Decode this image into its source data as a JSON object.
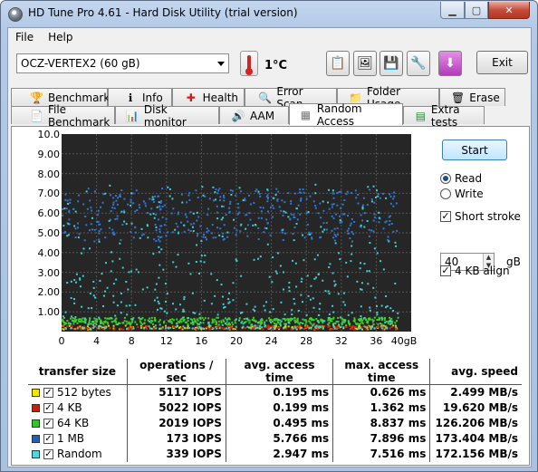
{
  "window": {
    "title": "HD Tune Pro 4.61 - Hard Disk Utility (trial version)"
  },
  "menu": [
    "File",
    "Help"
  ],
  "toolbar": {
    "drive": "OCZ-VERTEX2 (60 gB)",
    "temperature": "1°C",
    "exit_label": "Exit"
  },
  "tabs_row1": [
    {
      "label": "Benchmark",
      "icon": "benchmark-icon",
      "glyph": "🏆"
    },
    {
      "label": "Info",
      "icon": "info-icon",
      "glyph": "ℹ"
    },
    {
      "label": "Health",
      "icon": "health-icon",
      "glyph": "✚"
    },
    {
      "label": "Error Scan",
      "icon": "error-scan-icon",
      "glyph": "🔍"
    },
    {
      "label": "Folder Usage",
      "icon": "folder-icon",
      "glyph": "📁"
    },
    {
      "label": "Erase",
      "icon": "erase-icon",
      "glyph": "🗑"
    }
  ],
  "tabs_row2": [
    {
      "label": "File Benchmark",
      "icon": "file-benchmark-icon",
      "glyph": "📄"
    },
    {
      "label": "Disk monitor",
      "icon": "disk-monitor-icon",
      "glyph": "📊"
    },
    {
      "label": "AAM",
      "icon": "speaker-icon",
      "glyph": "🔊"
    },
    {
      "label": "Random Access",
      "icon": "random-access-icon",
      "glyph": "▦"
    },
    {
      "label": "Extra tests",
      "icon": "extra-tests-icon",
      "glyph": "▤"
    }
  ],
  "controls": {
    "start_label": "Start",
    "read_label": "Read",
    "write_label": "Write",
    "mode": "read",
    "short_stroke_label": "Short stroke",
    "short_stroke_checked": true,
    "short_stroke_value": "40",
    "short_stroke_unit": "gB",
    "align_label": "4 KB align",
    "align_checked": true
  },
  "chart_data": {
    "type": "scatter",
    "ylabel": "ms",
    "ylim": [
      0,
      10
    ],
    "xlim": [
      0,
      40
    ],
    "yticks": [
      "10.0",
      "9.00",
      "8.00",
      "7.00",
      "6.00",
      "5.00",
      "4.00",
      "3.00",
      "2.00",
      "1.00"
    ],
    "xticks": [
      "0",
      "4",
      "8",
      "12",
      "16",
      "20",
      "24",
      "28",
      "32",
      "36",
      "40gB"
    ],
    "series": [
      {
        "name": "512 bytes",
        "color": "#e8d400",
        "y_range": [
          0.15,
          0.35
        ]
      },
      {
        "name": "4 KB",
        "color": "#d42a10",
        "y_range": [
          0.15,
          0.35
        ]
      },
      {
        "name": "64 KB",
        "color": "#3fcf2a",
        "y_range": [
          0.4,
          0.75
        ]
      },
      {
        "name": "1 MB",
        "color": "#2f77d6",
        "y_range": [
          4.6,
          7.3
        ]
      },
      {
        "name": "Random",
        "color": "#3fd2d2",
        "y_range": [
          0.2,
          7.5
        ]
      }
    ]
  },
  "results": {
    "headers": [
      "transfer size",
      "operations / sec",
      "avg. access time",
      "max. access time",
      "avg. speed"
    ],
    "rows": [
      {
        "label": "512 bytes",
        "color": "#f2e600",
        "ops": "5117 IOPS",
        "avg": "0.195 ms",
        "max": "0.626 ms",
        "speed": "2.499 MB/s"
      },
      {
        "label": "4 KB",
        "color": "#c81e0a",
        "ops": "5022 IOPS",
        "avg": "0.199 ms",
        "max": "1.362 ms",
        "speed": "19.620 MB/s"
      },
      {
        "label": "64 KB",
        "color": "#3ac22a",
        "ops": "2019 IOPS",
        "avg": "0.495 ms",
        "max": "8.837 ms",
        "speed": "126.206 MB/s"
      },
      {
        "label": "1 MB",
        "color": "#1f5fc4",
        "ops": "173 IOPS",
        "avg": "5.766 ms",
        "max": "7.896 ms",
        "speed": "173.404 MB/s"
      },
      {
        "label": "Random",
        "color": "#4fd6e0",
        "ops": "339 IOPS",
        "avg": "2.947 ms",
        "max": "7.516 ms",
        "speed": "172.156 MB/s"
      }
    ]
  }
}
